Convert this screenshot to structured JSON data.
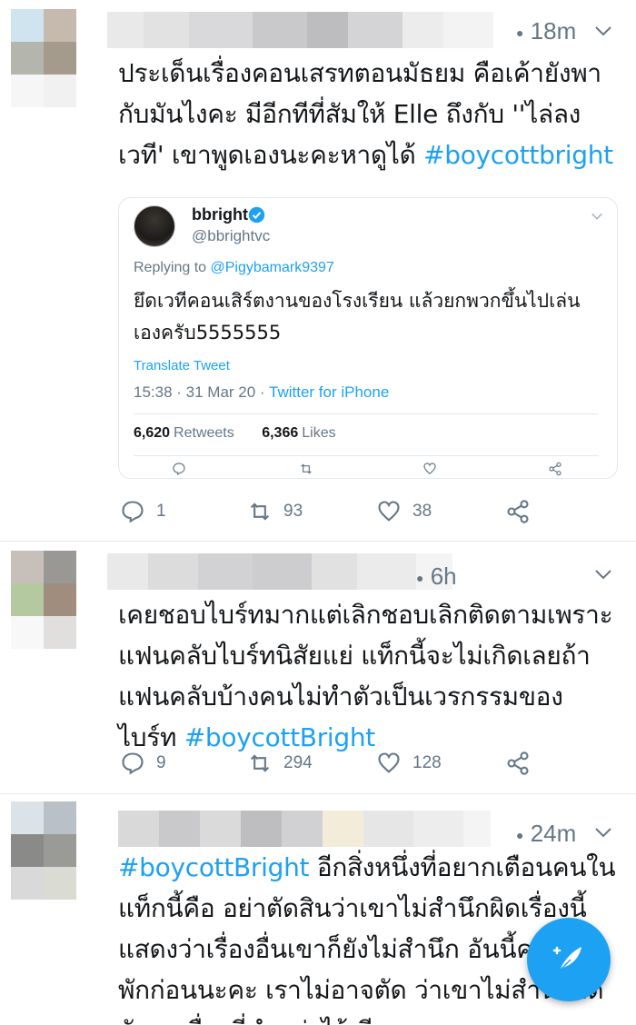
{
  "tweets": [
    {
      "time": "18m",
      "text_parts": [
        "ประเด็นเรื่องคอนเสรทตอนมัธยม คือเค้ายังพากับมันไงคะ มีอีกทีที่สัมให้ Elle ถึงกับ ''ไล่ลงเวที' เขาพูดเองนะคะหาดูได้ ",
        "#boycottbright"
      ],
      "replies": "1",
      "retweets": "93",
      "likes": "38",
      "quoted": {
        "name": "bbright",
        "handle": "@bbrightvc",
        "replying_label": "Replying to ",
        "replying_to": "@Pigybamark9397",
        "text": "ยึดเวทีคอนเสิร์ตงานของโรงเรียน แล้วยกพวกขึ้นไปเล่นเองครับ5555555",
        "translate": "Translate Tweet",
        "timestamp": "15:38 · 31 Mar 20 · ",
        "source": "Twitter for iPhone",
        "retweet_count": "6,620",
        "retweet_label": "Retweets",
        "like_count": "6,366",
        "like_label": "Likes"
      }
    },
    {
      "time": "6h",
      "text_parts": [
        "เคยชอบไบร์ทมากแต่เลิกชอบเลิกติดตามเพราะแฟนคลับไบร์ทนิสัยแย่ แท็กนี้จะไม่เกิดเลยถ้าแฟนคลับบ้างคนไม่ทำตัวเป็นเวรกรรมของไบร์ท ",
        "#boycottBright"
      ],
      "replies": "9",
      "retweets": "294",
      "likes": "128"
    },
    {
      "time": "24m",
      "text_parts": [
        "#boycottBright",
        " อีกสิ่งหนึ่งที่อยากเตือนคนในแท็กนี้คือ อย่าตัดสินว่าเขาไม่สำนึกผิดเรื่องนี้ แสดงว่าเรื่องอื่นเขาก็ยังไม่สำนึก อันนี้คงต้องพักก่อนนะคะ เราไม่อาจตัด ว่าเขาไม่สำนึกผิดกับทุกเรื่องที่ทำแย่ๆไว้เพียง"
      ]
    }
  ],
  "colors": {
    "accent": "#1da1f2",
    "text": "#14171a",
    "muted": "#657786",
    "border": "#e1e8ed"
  },
  "icons": [
    "reply-icon",
    "retweet-icon",
    "like-icon",
    "share-icon",
    "chevron-down-icon",
    "verified-icon",
    "compose-tweet-icon"
  ]
}
